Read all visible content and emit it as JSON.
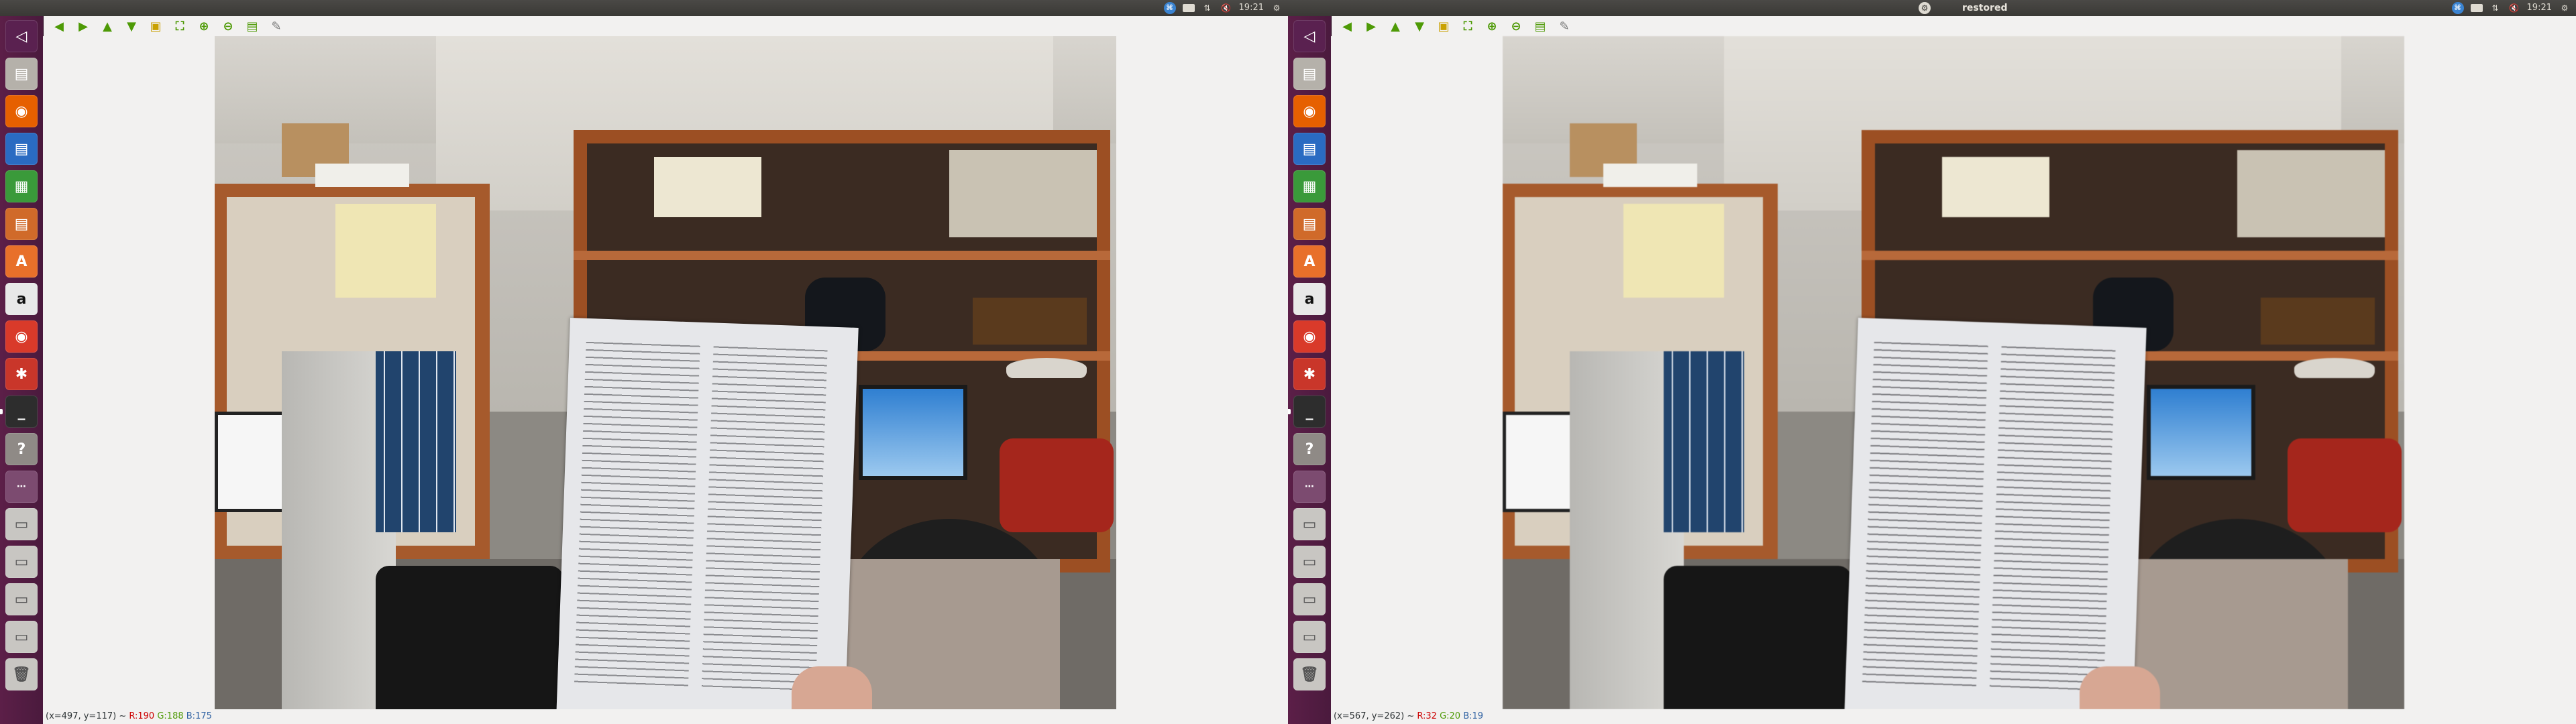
{
  "screens": [
    {
      "window_title": "",
      "status": {
        "coords": "(x=497, y=117) ~",
        "r": "R:190",
        "g": "G:188",
        "b": "B:175"
      }
    },
    {
      "window_title": "restored",
      "status": {
        "coords": "(x=567, y=262) ~",
        "r": "R:32",
        "g": "G:20",
        "b": "B:19"
      }
    }
  ],
  "tray": {
    "time": "19:21",
    "session_icon": "gear-icon",
    "sound_icon": "speaker-muted-icon",
    "network_icon": "network-arrows-icon",
    "keyboard_icon": "keyboard-icon",
    "chat_icon": "chat-icon"
  },
  "toolbar_icons": [
    "arrow-left-icon",
    "arrow-right-icon",
    "arrow-up-icon",
    "arrow-down-icon",
    "save-image-icon",
    "zoom-fit-icon",
    "zoom-in-icon",
    "zoom-out-icon",
    "save-icon",
    "properties-icon"
  ],
  "launcher_icons": [
    "back-icon",
    "files-icon",
    "firefox-icon",
    "writer-icon",
    "calc-icon",
    "impress-icon",
    "software-center-icon",
    "amazon-icon",
    "chrome-icon",
    "settings-icon",
    "terminal-icon",
    "help-icon",
    "workspace-icon",
    "drive-icon",
    "drive-icon",
    "drive-icon",
    "drive-icon",
    "trash-icon"
  ],
  "launcher_glyphs": [
    "◁",
    "▤",
    "◉",
    "▤",
    "▦",
    "▤",
    "A",
    "a",
    "◉",
    "✱",
    "_",
    "?",
    "⋯",
    "▭",
    "▭",
    "▭",
    "▭",
    "🗑"
  ],
  "colors": {
    "launcher": "#5c1f48",
    "status_r": "#cc0000",
    "status_g": "#4e9a06",
    "status_b": "#3465a4"
  }
}
